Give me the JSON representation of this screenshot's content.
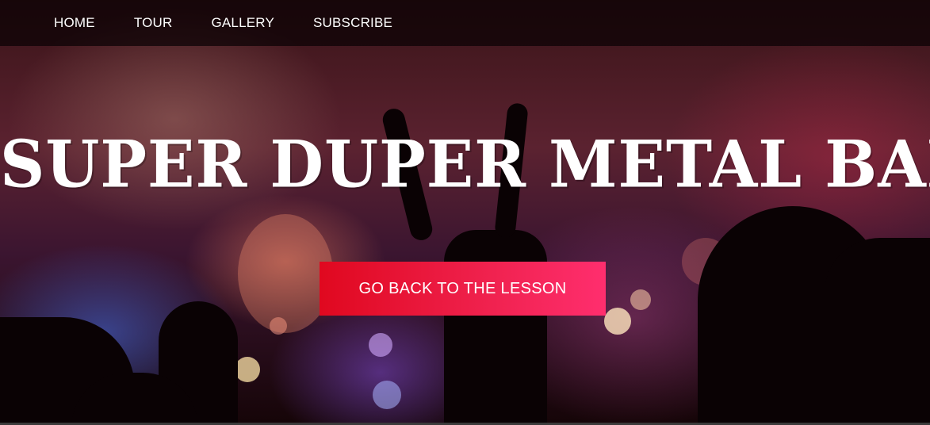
{
  "nav": {
    "items": [
      {
        "label": "HOME"
      },
      {
        "label": "TOUR"
      },
      {
        "label": "GALLERY"
      },
      {
        "label": "SUBSCRIBE"
      }
    ]
  },
  "hero": {
    "title": "SUPER DUPER METAL BAND",
    "button_label": "GO BACK TO THE LESSON",
    "button_color_start": "#e0081f",
    "button_color_end": "#ff2e6e"
  }
}
